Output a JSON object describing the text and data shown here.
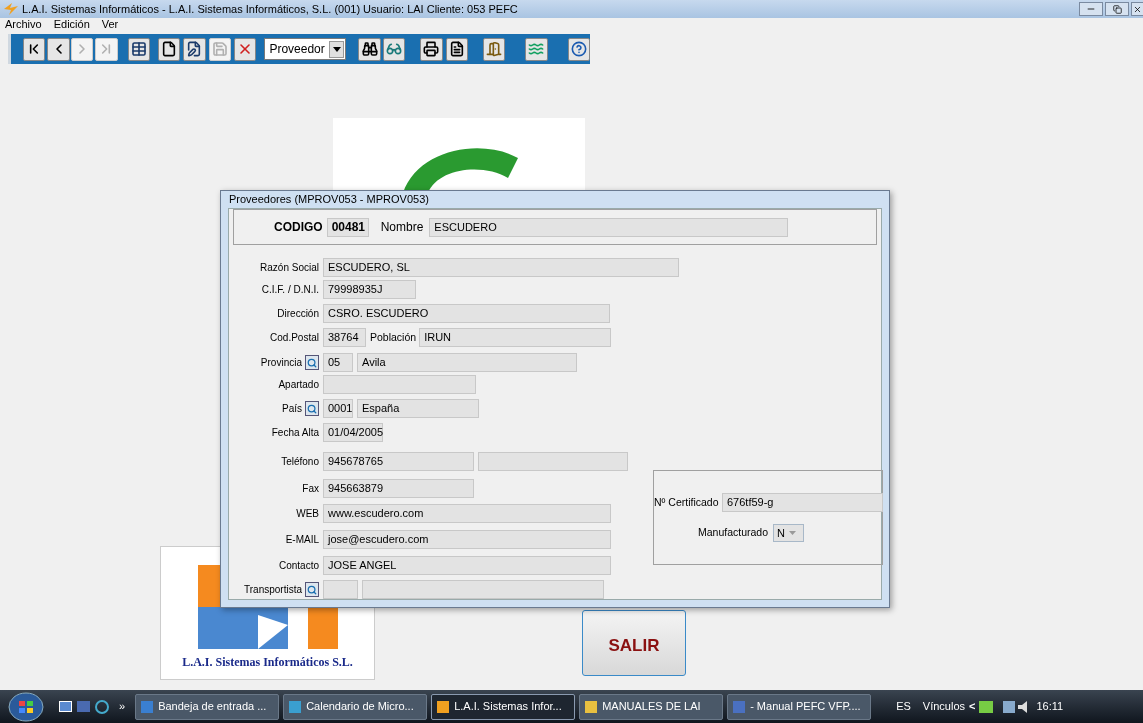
{
  "window": {
    "title": "L.A.I. Sistemas Informáticos - L.A.I. Sistemas Informáticos, S.L. (001)  Usuario: LAI   Cliente: 053  PEFC"
  },
  "menu": [
    "Archivo",
    "Edición",
    "Ver"
  ],
  "toolbar": [
    {
      "kind": "button",
      "disabled": false
    },
    {
      "kind": "button",
      "disabled": false
    },
    {
      "kind": "button",
      "disabled": true
    },
    {
      "kind": "button",
      "disabled": true
    },
    {
      "kind": "button",
      "disabled": false
    },
    {
      "kind": "button",
      "disabled": false
    },
    {
      "kind": "button",
      "disabled": false
    },
    {
      "kind": "button",
      "disabled": true
    },
    {
      "kind": "button",
      "disabled": false
    },
    {
      "kind": "combo",
      "value": "Proveedor"
    },
    {
      "kind": "button",
      "disabled": false
    },
    {
      "kind": "button",
      "disabled": false
    },
    {
      "kind": "button",
      "disabled": false
    },
    {
      "kind": "button",
      "disabled": false
    },
    {
      "kind": "button",
      "disabled": false
    },
    {
      "kind": "button",
      "disabled": false
    },
    {
      "kind": "button",
      "disabled": false
    }
  ],
  "background": {
    "company_logo_text": "L.A.I. Sistemas Informáticos S.L.",
    "exit_button": "SALIR"
  },
  "dialog": {
    "title": "Proveedores (MPROV053 - MPROV053)",
    "header": {
      "code_label": "CODIGO",
      "code_value": "00481",
      "name_label": "Nombre",
      "name_value": "ESCUDERO"
    },
    "fields": [
      {
        "label": "Razón Social",
        "lookup": false,
        "inputs": [
          {
            "kind": "text",
            "value": "ESCUDERO, SL"
          }
        ]
      },
      {
        "label": "C.I.F. / D.N.I.",
        "lookup": false,
        "inputs": [
          {
            "kind": "text",
            "value": "79998935J"
          }
        ]
      },
      {
        "label": "Dirección",
        "lookup": false,
        "inputs": [
          {
            "kind": "text",
            "value": "CSRO. ESCUDERO"
          }
        ]
      },
      {
        "label": "Cod.Postal",
        "lookup": false,
        "inputs": [
          {
            "kind": "text",
            "value": "38764"
          },
          {
            "kind": "text",
            "label": "Población",
            "value": "IRUN"
          }
        ]
      },
      {
        "label": "Provincia",
        "lookup": true,
        "inputs": [
          {
            "kind": "text",
            "value": "05"
          },
          {
            "kind": "text",
            "value": "Avila"
          }
        ]
      },
      {
        "label": "Apartado",
        "lookup": false,
        "inputs": [
          {
            "kind": "blank"
          }
        ]
      },
      {
        "label": "País",
        "lookup": true,
        "inputs": [
          {
            "kind": "text",
            "value": "0001"
          },
          {
            "kind": "text",
            "value": "España"
          }
        ]
      },
      {
        "label": "Fecha Alta",
        "lookup": false,
        "inputs": [
          {
            "kind": "text",
            "value": "01/04/2005"
          }
        ]
      },
      {
        "label": "Teléfono",
        "lookup": false,
        "inputs": [
          {
            "kind": "text",
            "value": "945678765"
          },
          {
            "kind": "blank"
          }
        ]
      },
      {
        "label": "Fax",
        "lookup": false,
        "inputs": [
          {
            "kind": "text",
            "value": "945663879"
          }
        ]
      },
      {
        "label": "WEB",
        "lookup": false,
        "inputs": [
          {
            "kind": "text",
            "value": "www.escudero.com"
          }
        ]
      },
      {
        "label": "E-MAIL",
        "lookup": false,
        "inputs": [
          {
            "kind": "text",
            "value": "jose@escudero.com"
          }
        ]
      },
      {
        "label": "Contacto",
        "lookup": false,
        "inputs": [
          {
            "kind": "text",
            "value": "JOSE ANGEL"
          }
        ]
      },
      {
        "label": "Transportista",
        "lookup": true,
        "inputs": [
          {
            "kind": "blank"
          },
          {
            "kind": "blank"
          }
        ]
      }
    ],
    "certificate": {
      "certificate_label": "Nº Certificado",
      "certificate_value": "676tf59-g",
      "manufactured_label": "Manufacturado",
      "manufactured_value": "N"
    }
  },
  "taskbar": {
    "items": [
      {
        "label": "Bandeja de entrada ...",
        "selected": false,
        "color": "#3a7fd0"
      },
      {
        "label": "Calendario de Micro...",
        "selected": false,
        "color": "#3a9fd0"
      },
      {
        "label": "L.A.I. Sistemas Infor...",
        "selected": true,
        "color": "#f0a020"
      },
      {
        "label": "MANUALES DE LAI",
        "selected": false,
        "color": "#e8c040"
      },
      {
        "label": "- Manual PEFC VFP....",
        "selected": false,
        "color": "#4a70c0"
      }
    ],
    "more": "»",
    "language": "ES",
    "links": "Vínculos",
    "links_arrow": "<",
    "clock": "16:11"
  }
}
